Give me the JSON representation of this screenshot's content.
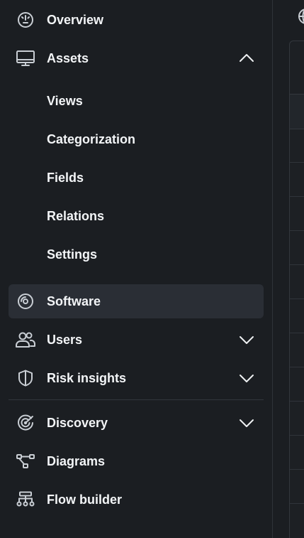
{
  "sidebar": {
    "items": [
      {
        "label": "Overview",
        "icon": "gauge-icon",
        "expandable": false
      },
      {
        "label": "Assets",
        "icon": "monitor-icon",
        "expandable": true,
        "expanded": true,
        "children": [
          "Views",
          "Categorization",
          "Fields",
          "Relations",
          "Settings"
        ]
      },
      {
        "label": "Software",
        "icon": "disc-icon",
        "expandable": false,
        "active": true
      },
      {
        "label": "Users",
        "icon": "users-icon",
        "expandable": true,
        "expanded": false
      },
      {
        "label": "Risk insights",
        "icon": "shield-icon",
        "expandable": true,
        "expanded": false
      },
      {
        "label": "Discovery",
        "icon": "radar-icon",
        "expandable": true,
        "expanded": false
      },
      {
        "label": "Diagrams",
        "icon": "diagram-icon",
        "expandable": false
      },
      {
        "label": "Flow builder",
        "icon": "flow-builder-icon",
        "expandable": false
      }
    ]
  },
  "colors": {
    "background": "#1b1e22",
    "active_item": "#2a2e35",
    "text": "#f3f5f7",
    "icon": "#c9ced4",
    "divider": "#33373d"
  },
  "right_panel": {
    "icon": "globe-icon"
  }
}
